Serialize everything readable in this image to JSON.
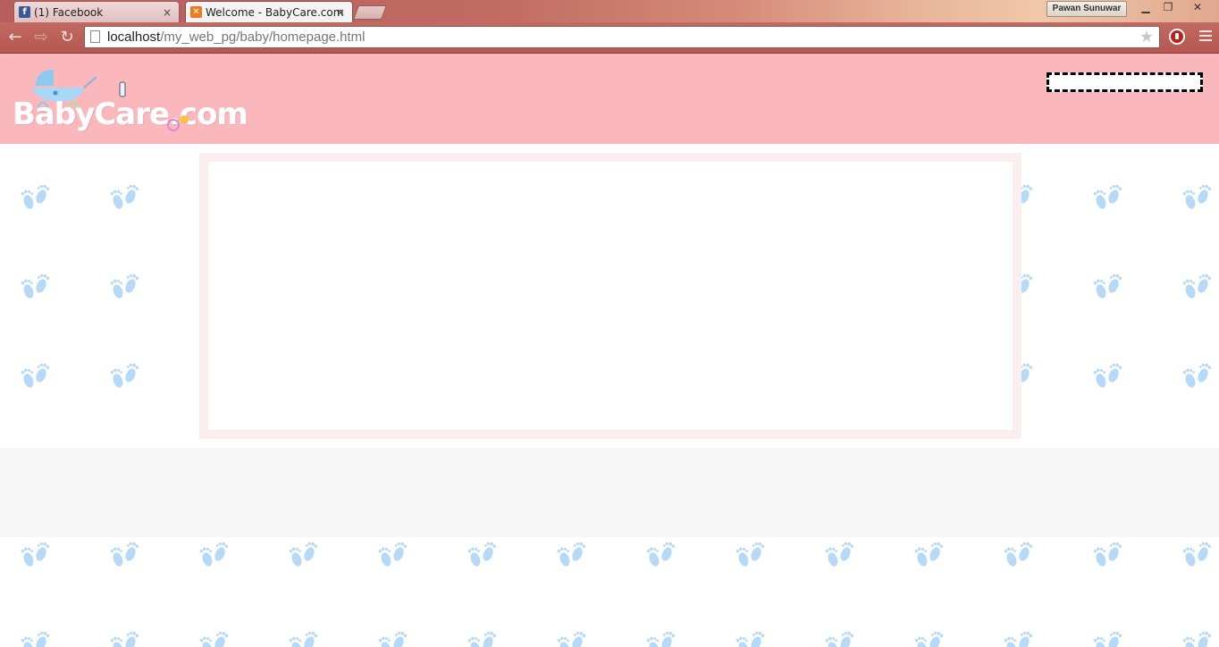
{
  "browser": {
    "tabs": [
      {
        "title": "(1) Facebook",
        "favicon": "facebook-icon",
        "active": false
      },
      {
        "title": "Welcome - BabyCare.com",
        "favicon": "xampp-icon",
        "active": true
      }
    ],
    "tab_close": "×",
    "profile_name": "Pawan Sunuwar",
    "window_controls": {
      "minimize": "▁",
      "restore": "❐",
      "close": "✕"
    },
    "nav": {
      "back": "←",
      "forward": "⇨",
      "reload": "↻"
    },
    "address": {
      "host": "localhost",
      "path": "/my_web_pg/baby/homepage.html"
    },
    "bookmark_star": "★"
  },
  "site": {
    "logo_text": "BabyCare.com",
    "colors": {
      "header": "#fab8bd",
      "feet": "#b6d9f7",
      "content_border": "#fbeeee",
      "band": "#f6f6f6"
    }
  }
}
